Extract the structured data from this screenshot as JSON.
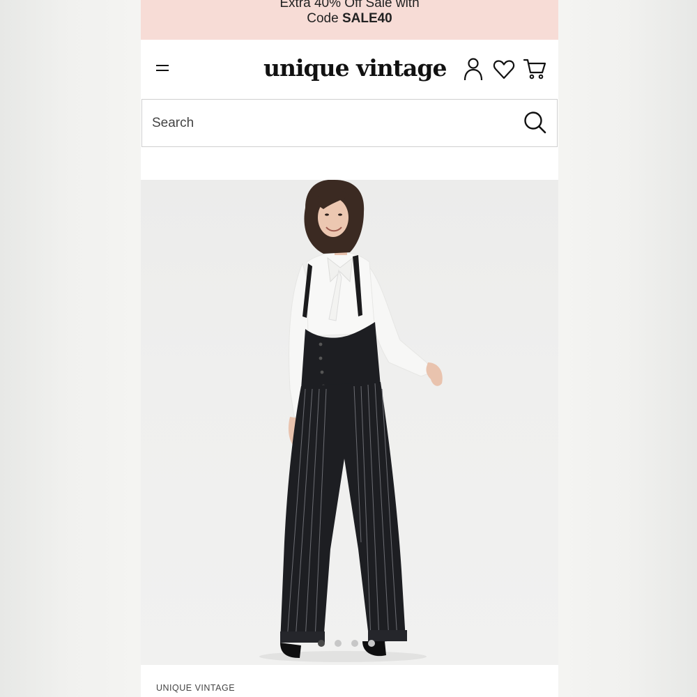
{
  "promo": {
    "line1": "Extra 40% Off Sale with",
    "code_prefix": "Code ",
    "code": "SALE40"
  },
  "header": {
    "logo": "unique vintage",
    "menu_icon": "hamburger-icon",
    "account_icon": "user-icon",
    "wishlist_icon": "heart-icon",
    "cart_icon": "cart-icon"
  },
  "search": {
    "placeholder": "Search",
    "value": "",
    "icon": "search-icon"
  },
  "product": {
    "brand": "UNIQUE VINTAGE",
    "image": {
      "slide_count": 4,
      "active_slide": 1
    }
  },
  "colors": {
    "promo_bg": "#f7dcd6",
    "text": "#111111",
    "photo_bg": "#efefee"
  }
}
